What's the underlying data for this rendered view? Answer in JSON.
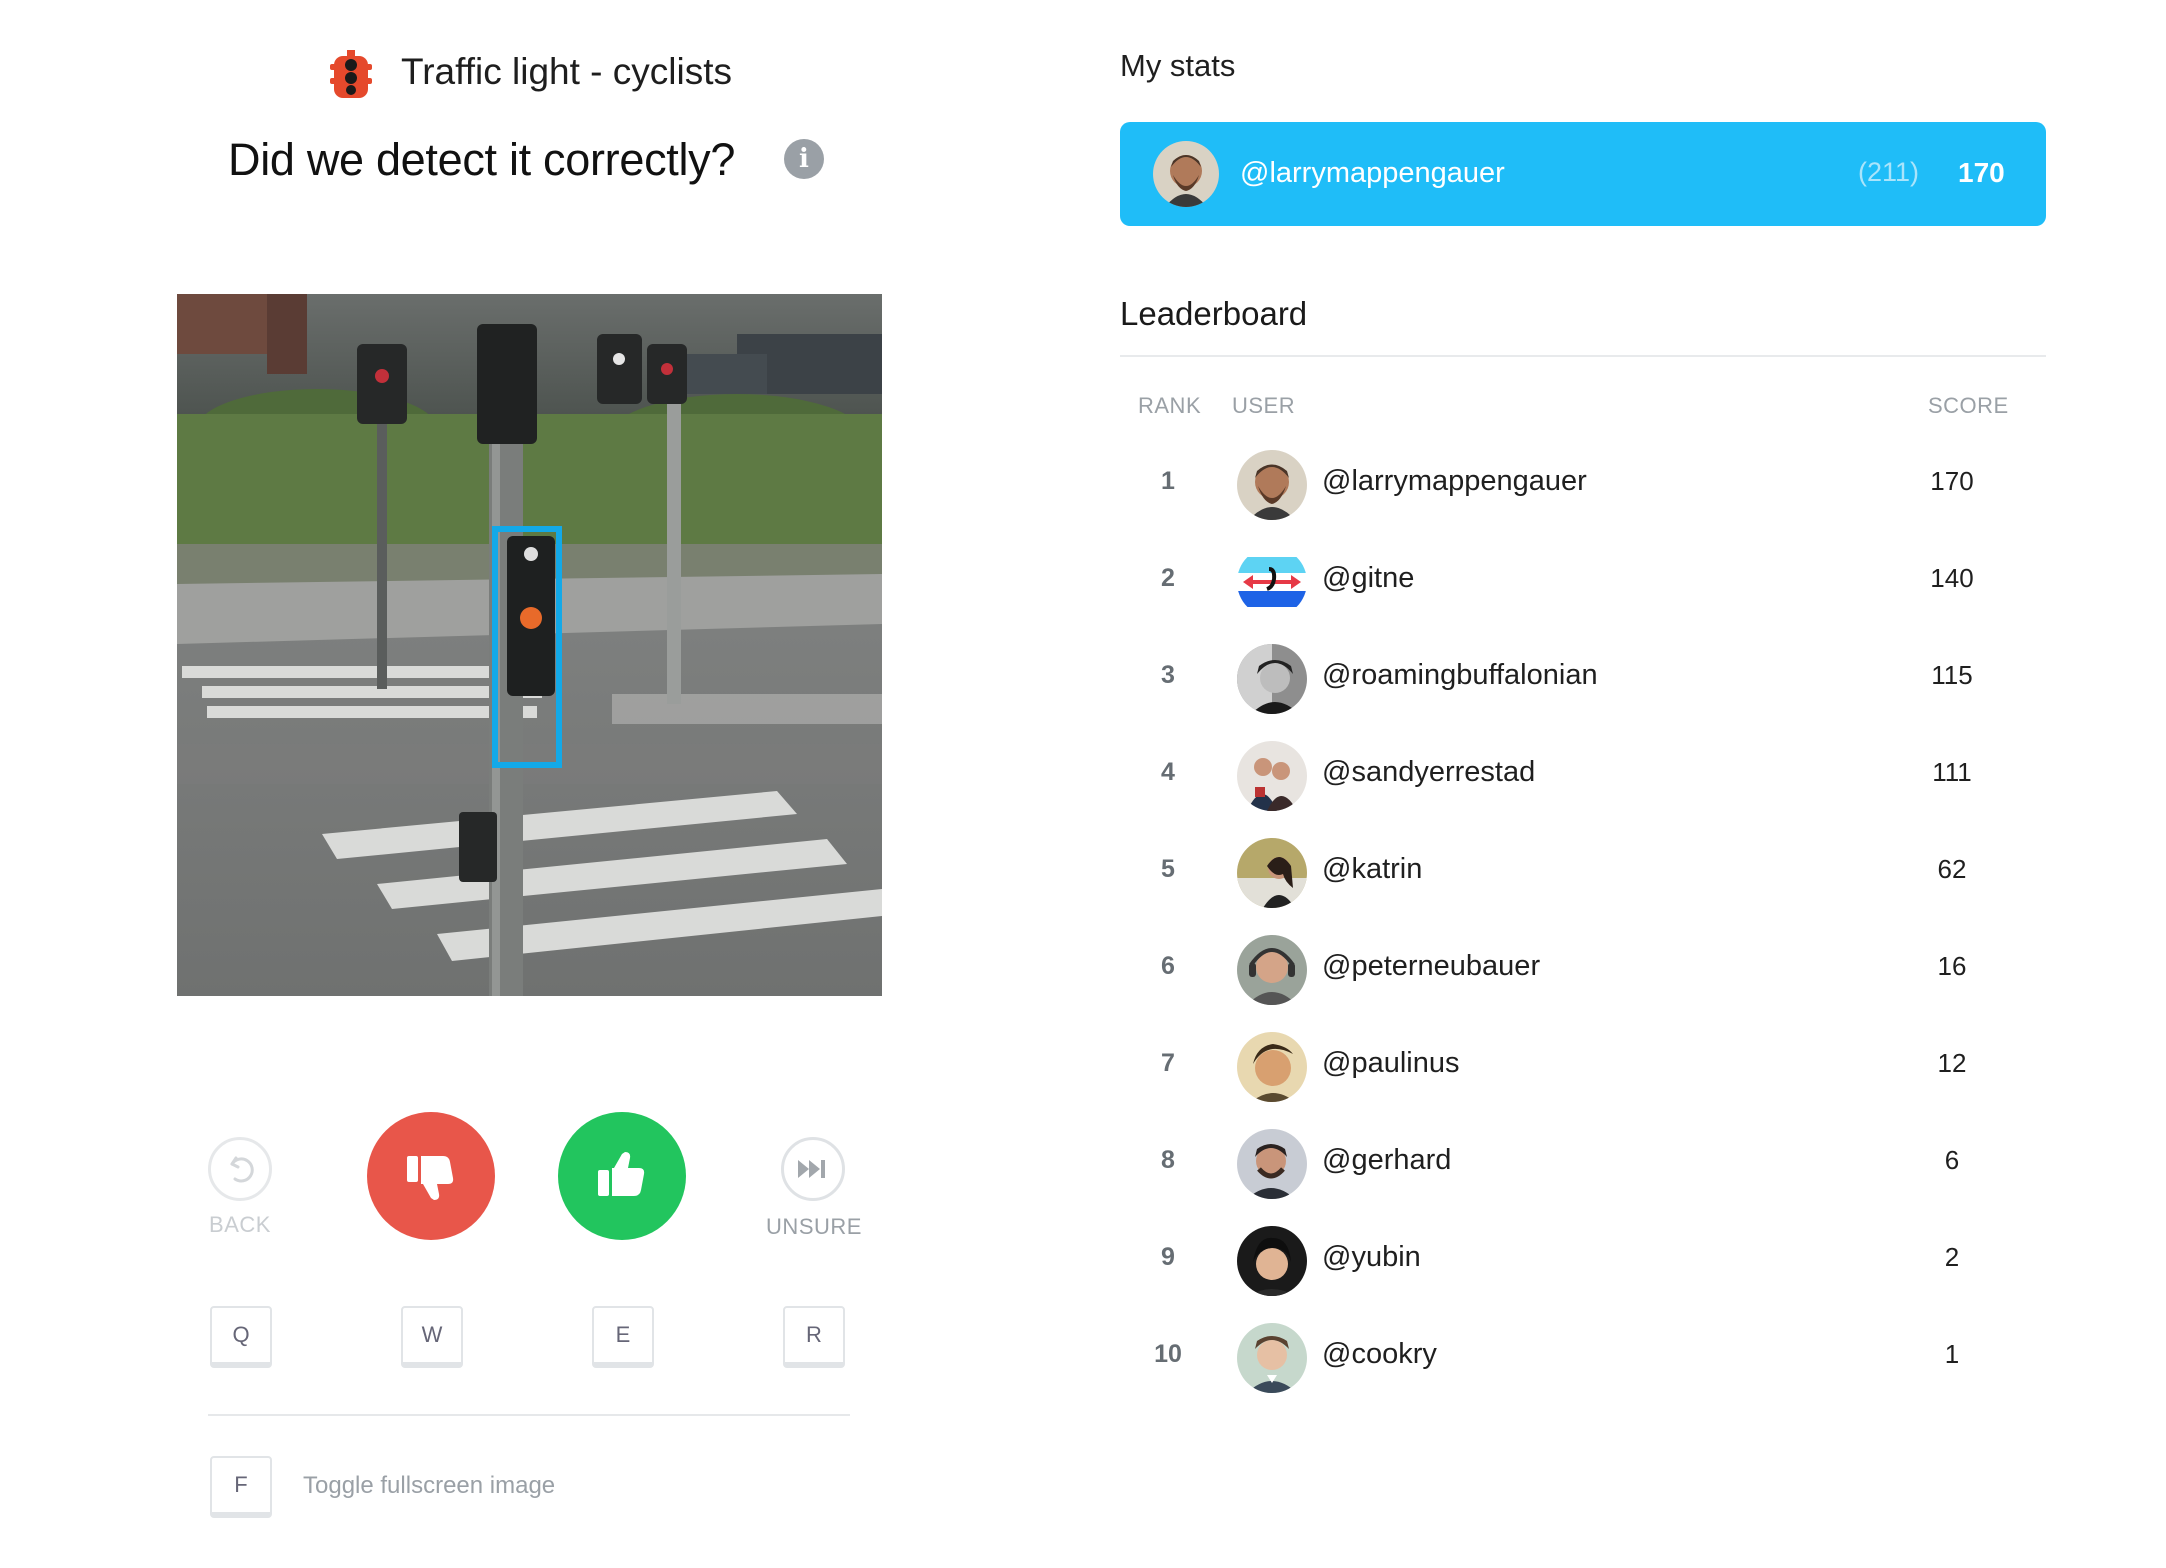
{
  "header": {
    "category_icon": "traffic-light-icon",
    "category_title": "Traffic light - cyclists",
    "question": "Did we detect it correctly?",
    "info_icon": "info-icon",
    "info_glyph": "i"
  },
  "actions": {
    "back_label": "BACK",
    "unsure_label": "UNSURE",
    "no_icon": "thumbs-down-icon",
    "yes_icon": "thumbs-up-icon",
    "back_icon": "undo-icon",
    "unsure_icon": "skip-forward-icon",
    "no_color": "#e8564a",
    "yes_color": "#22c55e"
  },
  "shortcuts": {
    "keys": [
      "Q",
      "W",
      "E",
      "R"
    ],
    "fullscreen_key": "F",
    "fullscreen_label": "Toggle fullscreen image"
  },
  "my_stats": {
    "title": "My stats",
    "user": "@larrymappengauer",
    "total": "(211)",
    "score": "170",
    "bar_color": "#1fbdf8"
  },
  "leaderboard": {
    "title": "Leaderboard",
    "columns": {
      "rank": "RANK",
      "user": "USER",
      "score": "SCORE"
    },
    "rows": [
      {
        "rank": "1",
        "user": "@larrymappengauer",
        "score": "170"
      },
      {
        "rank": "2",
        "user": "@gitne",
        "score": "140"
      },
      {
        "rank": "3",
        "user": "@roamingbuffalonian",
        "score": "115"
      },
      {
        "rank": "4",
        "user": "@sandyerrestad",
        "score": "111"
      },
      {
        "rank": "5",
        "user": "@katrin",
        "score": "62"
      },
      {
        "rank": "6",
        "user": "@peterneubauer",
        "score": "16"
      },
      {
        "rank": "7",
        "user": "@paulinus",
        "score": "12"
      },
      {
        "rank": "8",
        "user": "@gerhard",
        "score": "6"
      },
      {
        "rank": "9",
        "user": "@yubin",
        "score": "2"
      },
      {
        "rank": "10",
        "user": "@cookry",
        "score": "1"
      }
    ]
  }
}
